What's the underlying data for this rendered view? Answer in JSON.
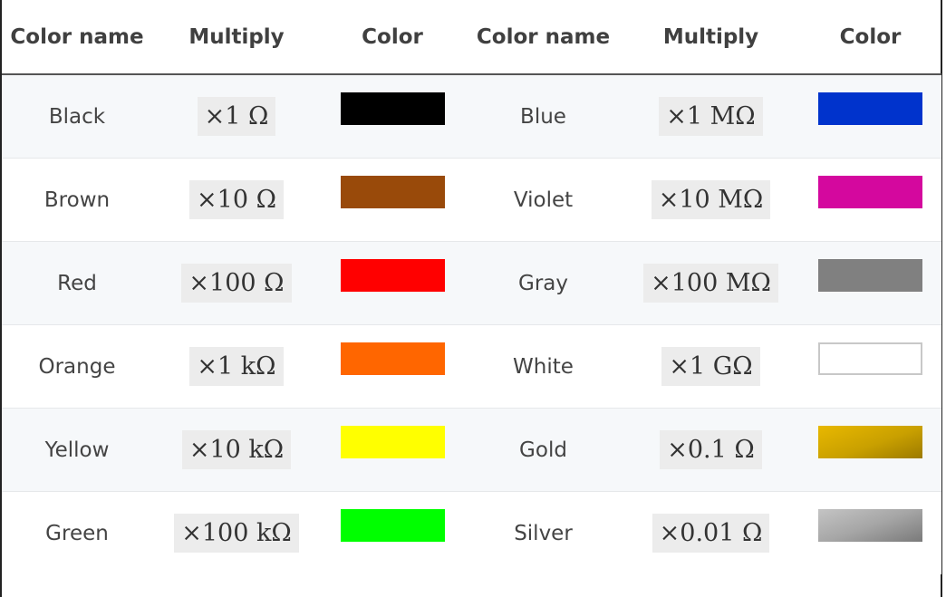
{
  "headers": [
    "Color name",
    "Multiply",
    "Color",
    "Color name",
    "Multiply",
    "Color"
  ],
  "rows": [
    {
      "left": {
        "name": "Black",
        "multiplier": "×1 Ω",
        "color": "#000000"
      },
      "right": {
        "name": "Blue",
        "multiplier": "×1 MΩ",
        "color": "#0033cc"
      }
    },
    {
      "left": {
        "name": "Brown",
        "multiplier": "×10 Ω",
        "color": "#994a0a"
      },
      "right": {
        "name": "Violet",
        "multiplier": "×10 MΩ",
        "color": "#d4089e"
      }
    },
    {
      "left": {
        "name": "Red",
        "multiplier": "×100 Ω",
        "color": "#ff0000"
      },
      "right": {
        "name": "Gray",
        "multiplier": "×100 MΩ",
        "color": "#808080"
      }
    },
    {
      "left": {
        "name": "Orange",
        "multiplier": "×1 kΩ",
        "color": "#ff6600"
      },
      "right": {
        "name": "White",
        "multiplier": "×1 GΩ",
        "color": "#ffffff"
      }
    },
    {
      "left": {
        "name": "Yellow",
        "multiplier": "×10 kΩ",
        "color": "#ffff00"
      },
      "right": {
        "name": "Gold",
        "multiplier": "×0.1 Ω",
        "color": "#d4a800"
      }
    },
    {
      "left": {
        "name": "Green",
        "multiplier": "×100 kΩ",
        "color": "#00ff00"
      },
      "right": {
        "name": "Silver",
        "multiplier": "×0.01 Ω",
        "color": "#a0a0a0"
      }
    }
  ]
}
